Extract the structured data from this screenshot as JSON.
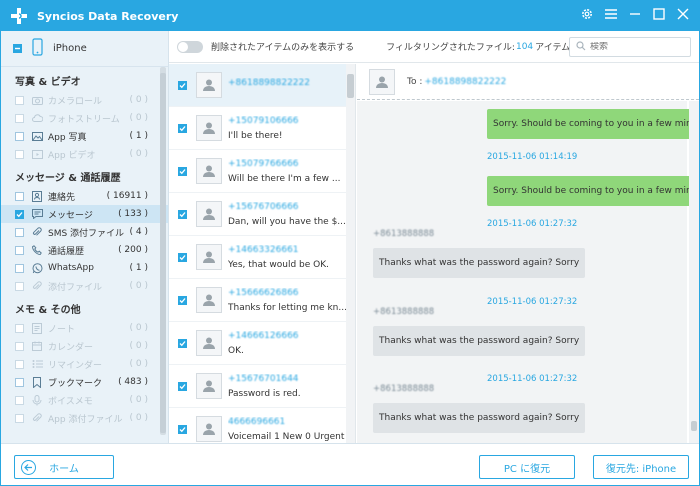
{
  "app": {
    "title": "Syncios Data Recovery"
  },
  "device": {
    "name": "iPhone"
  },
  "sidebar": {
    "categories": [
      {
        "title": "写真 & ビデオ",
        "items": [
          {
            "label": "カメラロール",
            "count": "( 0 )",
            "enabled": false,
            "checked": false,
            "icon": "camera-icon"
          },
          {
            "label": "フォトストリーム",
            "count": "( 0 )",
            "enabled": false,
            "checked": false,
            "icon": "cloud-icon"
          },
          {
            "label": "App 写真",
            "count": "( 1 )",
            "enabled": true,
            "checked": false,
            "icon": "image-icon"
          },
          {
            "label": "App ビデオ",
            "count": "( 0 )",
            "enabled": false,
            "checked": false,
            "icon": "video-icon"
          }
        ]
      },
      {
        "title": "メッセージ & 通話履歴",
        "items": [
          {
            "label": "連絡先",
            "count": "( 16911 )",
            "enabled": true,
            "checked": false,
            "icon": "contacts-icon"
          },
          {
            "label": "メッセージ",
            "count": "( 133 )",
            "enabled": true,
            "checked": true,
            "icon": "message-icon"
          },
          {
            "label": "SMS 添付ファイル",
            "count": "( 4 )",
            "enabled": true,
            "checked": false,
            "icon": "attachment-icon"
          },
          {
            "label": "通話履歴",
            "count": "( 200 )",
            "enabled": true,
            "checked": false,
            "icon": "phone-icon"
          },
          {
            "label": "WhatsApp",
            "count": "( 1 )",
            "enabled": true,
            "checked": false,
            "icon": "whatsapp-icon"
          },
          {
            "label": "添付ファイル",
            "count": "( 0 )",
            "enabled": false,
            "checked": false,
            "icon": "attachment-icon"
          }
        ]
      },
      {
        "title": "メモ & その他",
        "items": [
          {
            "label": "ノート",
            "count": "( 0 )",
            "enabled": false,
            "checked": false,
            "icon": "note-icon"
          },
          {
            "label": "カレンダー",
            "count": "( 0 )",
            "enabled": false,
            "checked": false,
            "icon": "calendar-icon"
          },
          {
            "label": "リマインダー",
            "count": "( 0 )",
            "enabled": false,
            "checked": false,
            "icon": "reminder-icon"
          },
          {
            "label": "ブックマーク",
            "count": "( 483 )",
            "enabled": true,
            "checked": false,
            "icon": "bookmark-icon"
          },
          {
            "label": "ボイスメモ",
            "count": "( 0 )",
            "enabled": false,
            "checked": false,
            "icon": "voice-memo-icon"
          },
          {
            "label": "App 添付ファイル",
            "count": "( 0 )",
            "enabled": false,
            "checked": false,
            "icon": "attachment-icon"
          }
        ]
      }
    ]
  },
  "toolbar": {
    "toggle_label": "削除されたアイテムのみを表示する",
    "filter_label": "フィルタリングされたファイル:",
    "filter_count": "104",
    "filter_unit": "アイテム",
    "search_placeholder": "検索"
  },
  "messages": [
    {
      "number": "+8618898822222",
      "preview": ""
    },
    {
      "number": "+15079106666",
      "preview": "I'll be there!"
    },
    {
      "number": "+15079766666",
      "preview": "Will be there I'm a few ..."
    },
    {
      "number": "+15676706666",
      "preview": "Dan, will you have the $..."
    },
    {
      "number": "+14663326661",
      "preview": "Yes, that would be OK."
    },
    {
      "number": "+15666626866",
      "preview": "Thanks for letting me kn..."
    },
    {
      "number": "+14666126666",
      "preview": "OK."
    },
    {
      "number": "+15676701644",
      "preview": "Password is red."
    },
    {
      "number": "4666696661",
      "preview": "Voicemail 1 New 0 Urgent"
    }
  ],
  "conversation": {
    "to_label": "To :",
    "to_number": "+8618898822222",
    "entries": [
      {
        "type": "out",
        "text": "Sorry. Should be coming to you in a few minutes"
      },
      {
        "type": "time",
        "text": "2015-11-06 01:14:19"
      },
      {
        "type": "out",
        "text": "Sorry. Should be coming to you in a few minutes"
      },
      {
        "type": "time",
        "text": "2015-11-06 01:27:32"
      },
      {
        "type": "sender",
        "text": "+8613888888"
      },
      {
        "type": "in",
        "text": "Thanks what was the password again? Sorry"
      },
      {
        "type": "time",
        "text": "2015-11-06 01:27:32"
      },
      {
        "type": "sender",
        "text": "+8613888888"
      },
      {
        "type": "in",
        "text": "Thanks what was the password again? Sorry"
      },
      {
        "type": "time",
        "text": "2015-11-06 01:27:32"
      },
      {
        "type": "sender",
        "text": "+8613888888"
      },
      {
        "type": "in",
        "text": "Thanks what was the password again? Sorry"
      }
    ]
  },
  "bottom": {
    "home_label": "ホーム",
    "restore_pc_label": "PC に復元",
    "restore_iphone_label": "復元先: iPhone"
  }
}
